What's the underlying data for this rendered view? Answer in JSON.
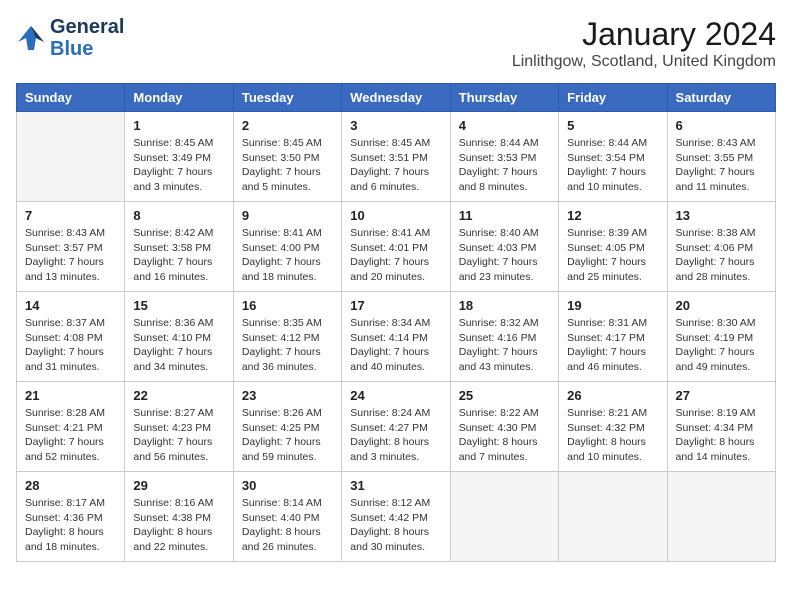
{
  "header": {
    "logo_line1": "General",
    "logo_line2": "Blue",
    "month_title": "January 2024",
    "location": "Linlithgow, Scotland, United Kingdom"
  },
  "weekdays": [
    "Sunday",
    "Monday",
    "Tuesday",
    "Wednesday",
    "Thursday",
    "Friday",
    "Saturday"
  ],
  "weeks": [
    [
      {
        "day": "",
        "info": ""
      },
      {
        "day": "1",
        "info": "Sunrise: 8:45 AM\nSunset: 3:49 PM\nDaylight: 7 hours\nand 3 minutes."
      },
      {
        "day": "2",
        "info": "Sunrise: 8:45 AM\nSunset: 3:50 PM\nDaylight: 7 hours\nand 5 minutes."
      },
      {
        "day": "3",
        "info": "Sunrise: 8:45 AM\nSunset: 3:51 PM\nDaylight: 7 hours\nand 6 minutes."
      },
      {
        "day": "4",
        "info": "Sunrise: 8:44 AM\nSunset: 3:53 PM\nDaylight: 7 hours\nand 8 minutes."
      },
      {
        "day": "5",
        "info": "Sunrise: 8:44 AM\nSunset: 3:54 PM\nDaylight: 7 hours\nand 10 minutes."
      },
      {
        "day": "6",
        "info": "Sunrise: 8:43 AM\nSunset: 3:55 PM\nDaylight: 7 hours\nand 11 minutes."
      }
    ],
    [
      {
        "day": "7",
        "info": "Sunrise: 8:43 AM\nSunset: 3:57 PM\nDaylight: 7 hours\nand 13 minutes."
      },
      {
        "day": "8",
        "info": "Sunrise: 8:42 AM\nSunset: 3:58 PM\nDaylight: 7 hours\nand 16 minutes."
      },
      {
        "day": "9",
        "info": "Sunrise: 8:41 AM\nSunset: 4:00 PM\nDaylight: 7 hours\nand 18 minutes."
      },
      {
        "day": "10",
        "info": "Sunrise: 8:41 AM\nSunset: 4:01 PM\nDaylight: 7 hours\nand 20 minutes."
      },
      {
        "day": "11",
        "info": "Sunrise: 8:40 AM\nSunset: 4:03 PM\nDaylight: 7 hours\nand 23 minutes."
      },
      {
        "day": "12",
        "info": "Sunrise: 8:39 AM\nSunset: 4:05 PM\nDaylight: 7 hours\nand 25 minutes."
      },
      {
        "day": "13",
        "info": "Sunrise: 8:38 AM\nSunset: 4:06 PM\nDaylight: 7 hours\nand 28 minutes."
      }
    ],
    [
      {
        "day": "14",
        "info": "Sunrise: 8:37 AM\nSunset: 4:08 PM\nDaylight: 7 hours\nand 31 minutes."
      },
      {
        "day": "15",
        "info": "Sunrise: 8:36 AM\nSunset: 4:10 PM\nDaylight: 7 hours\nand 34 minutes."
      },
      {
        "day": "16",
        "info": "Sunrise: 8:35 AM\nSunset: 4:12 PM\nDaylight: 7 hours\nand 36 minutes."
      },
      {
        "day": "17",
        "info": "Sunrise: 8:34 AM\nSunset: 4:14 PM\nDaylight: 7 hours\nand 40 minutes."
      },
      {
        "day": "18",
        "info": "Sunrise: 8:32 AM\nSunset: 4:16 PM\nDaylight: 7 hours\nand 43 minutes."
      },
      {
        "day": "19",
        "info": "Sunrise: 8:31 AM\nSunset: 4:17 PM\nDaylight: 7 hours\nand 46 minutes."
      },
      {
        "day": "20",
        "info": "Sunrise: 8:30 AM\nSunset: 4:19 PM\nDaylight: 7 hours\nand 49 minutes."
      }
    ],
    [
      {
        "day": "21",
        "info": "Sunrise: 8:28 AM\nSunset: 4:21 PM\nDaylight: 7 hours\nand 52 minutes."
      },
      {
        "day": "22",
        "info": "Sunrise: 8:27 AM\nSunset: 4:23 PM\nDaylight: 7 hours\nand 56 minutes."
      },
      {
        "day": "23",
        "info": "Sunrise: 8:26 AM\nSunset: 4:25 PM\nDaylight: 7 hours\nand 59 minutes."
      },
      {
        "day": "24",
        "info": "Sunrise: 8:24 AM\nSunset: 4:27 PM\nDaylight: 8 hours\nand 3 minutes."
      },
      {
        "day": "25",
        "info": "Sunrise: 8:22 AM\nSunset: 4:30 PM\nDaylight: 8 hours\nand 7 minutes."
      },
      {
        "day": "26",
        "info": "Sunrise: 8:21 AM\nSunset: 4:32 PM\nDaylight: 8 hours\nand 10 minutes."
      },
      {
        "day": "27",
        "info": "Sunrise: 8:19 AM\nSunset: 4:34 PM\nDaylight: 8 hours\nand 14 minutes."
      }
    ],
    [
      {
        "day": "28",
        "info": "Sunrise: 8:17 AM\nSunset: 4:36 PM\nDaylight: 8 hours\nand 18 minutes."
      },
      {
        "day": "29",
        "info": "Sunrise: 8:16 AM\nSunset: 4:38 PM\nDaylight: 8 hours\nand 22 minutes."
      },
      {
        "day": "30",
        "info": "Sunrise: 8:14 AM\nSunset: 4:40 PM\nDaylight: 8 hours\nand 26 minutes."
      },
      {
        "day": "31",
        "info": "Sunrise: 8:12 AM\nSunset: 4:42 PM\nDaylight: 8 hours\nand 30 minutes."
      },
      {
        "day": "",
        "info": ""
      },
      {
        "day": "",
        "info": ""
      },
      {
        "day": "",
        "info": ""
      }
    ]
  ]
}
